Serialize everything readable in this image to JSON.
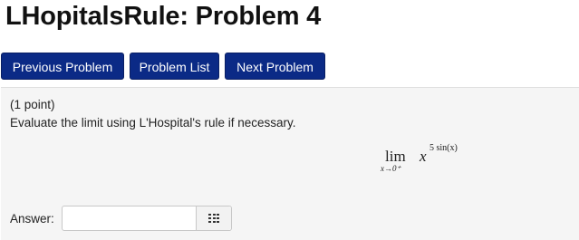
{
  "page": {
    "title": "LHopitalsRule: Problem 4"
  },
  "nav": {
    "previous_label": "Previous Problem",
    "list_label": "Problem List",
    "next_label": "Next Problem"
  },
  "problem": {
    "points": "(1 point)",
    "question": "Evaluate the limit using L'Hospital's rule if necessary.",
    "math": {
      "lim": "lim",
      "limit_subscript": "x→0⁺",
      "base": "x",
      "exponent": "5 sin(x)"
    }
  },
  "answer": {
    "label": "Answer:",
    "value": "",
    "keypad_icon": "grid-keypad-icon"
  },
  "colors": {
    "button_bg": "#0b2a86",
    "panel_bg": "#f5f5f5"
  }
}
